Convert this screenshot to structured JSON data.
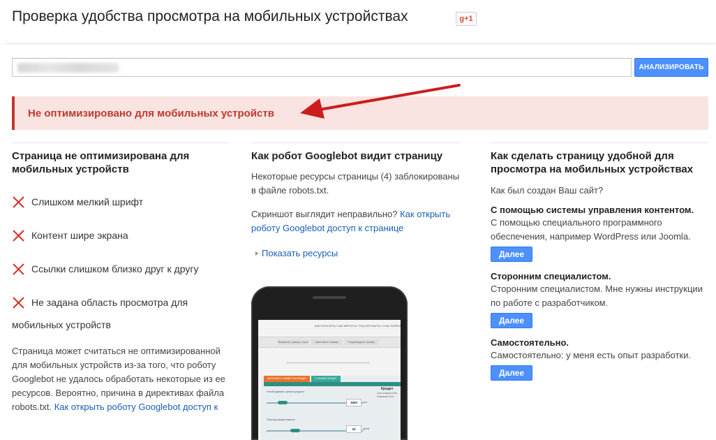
{
  "header": {
    "title": "Проверка удобства просмотра на мобильных устройствах",
    "gplus_label": "g+1"
  },
  "search": {
    "value": "",
    "analyze_label": "АНАЛИЗИРОВАТЬ"
  },
  "alert": {
    "text": "Не оптимизировано для мобильных устройств",
    "accent_color": "#c5352a",
    "arrow_color": "#cc1d1d"
  },
  "col1": {
    "title": "Страница не оптимизирована для мобильных устройств",
    "issues": [
      "Слишком мелкий шрифт",
      "Контент шире экрана",
      "Ссылки слишком близко друг к другу",
      "Не задана область просмотра для",
      "мобильных устройств"
    ],
    "issue_icon": "red-x-icon",
    "explanation": "Страница может считаться не оптимизированной для мобильных устройств из-за того, что роботу Googlebot не удалось обработать некоторые из ее ресурсов. Вероятно, причина в директивах файла robots.txt.",
    "explanation_link": "Как открыть роботу Googlebot доступ к"
  },
  "col2": {
    "title": "Как робот Googlebot видит страницу",
    "blocked_text": "Некоторые ресурсы страницы (4) заблокированы в файле robots.txt.",
    "screenshot_question": "Скриншот выглядит неправильно?",
    "screenshot_link": "Как открыть роботу Googlebot доступ к странице",
    "show_resources": "Показать ресурсы",
    "phone": {
      "nav_text": "КАК ПОЛУЧИТЬ?   КАК ВЕРНУТЬ?   FAQ   КОНТАКТЫ   О НАС   ВОЙТИ",
      "tabs": [
        "Выберите сумму и срок",
        "Заполните заявку",
        "Подтвердите заявку"
      ],
      "tab_orange": "ЗАПОЛНИТЬ ЗАЯВКУ НА КРЕДИТ",
      "tab_teal": "О НАШЕЙ КРЕДИТ",
      "label_amount": "Необходимая сумма кредита",
      "amount_value": "1500",
      "amount_unit": "грн.",
      "label_period": "Период кредитования",
      "period_value": "15",
      "period_unit": "дней",
      "side_title": "Кредит",
      "side_text": "Срок возврата Вы Компании Игос"
    }
  },
  "col3": {
    "title": "Как сделать страницу удобной для просмотра на мобильных устройствах",
    "question": "Как был создан Ваш сайт?",
    "options": [
      {
        "title": "С помощью системы управления контентом.",
        "desc": "С помощью специального программного обеспечения, например WordPress или Joomla.",
        "button": "Далее"
      },
      {
        "title": "Сторонним специалистом.",
        "desc": "Сторонним специалистом. Мне нужны инструкции по работе с разработчиком.",
        "button": "Далее"
      },
      {
        "title": "Самостоятельно.",
        "desc": "Самостоятельно: у меня есть опыт разработки.",
        "button": "Далее"
      }
    ]
  }
}
